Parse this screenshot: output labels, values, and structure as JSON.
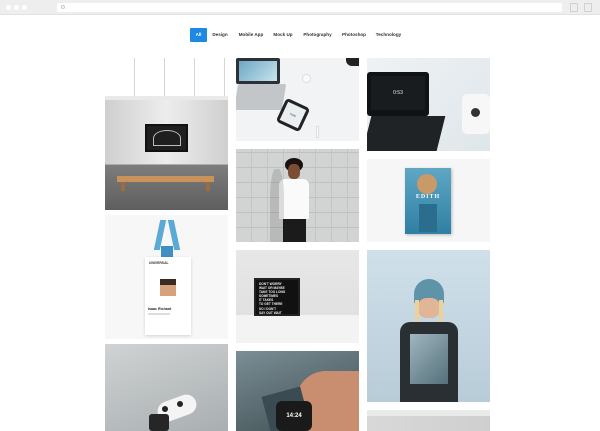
{
  "filters": {
    "items": [
      {
        "label": "All",
        "active": true
      },
      {
        "label": "Design",
        "active": false
      },
      {
        "label": "Mobile App",
        "active": false
      },
      {
        "label": "Mock Up",
        "active": false
      },
      {
        "label": "Photography",
        "active": false
      },
      {
        "label": "Photoshop",
        "active": false
      },
      {
        "label": "Technology",
        "active": false
      }
    ]
  },
  "gallery": {
    "laptop_screen_time": "0:53",
    "phone_screen_text": "Hello",
    "magazine_title": "EDITH",
    "badge_company": "UNIVERSAL",
    "badge_name": "Isaac Richard",
    "lightbox_lines": [
      "DON'T WORRY",
      "WAIT OR MAYBE",
      "TAKE TOO LONG",
      "SOMETIMES",
      "IT TAKES",
      "TO GET THERE",
      "SO I DON'T",
      "SAY OUT WAIT"
    ],
    "watch_time": "14:24"
  },
  "colors": {
    "accent": "#1e88e5",
    "chrome": "#eeeeee"
  }
}
